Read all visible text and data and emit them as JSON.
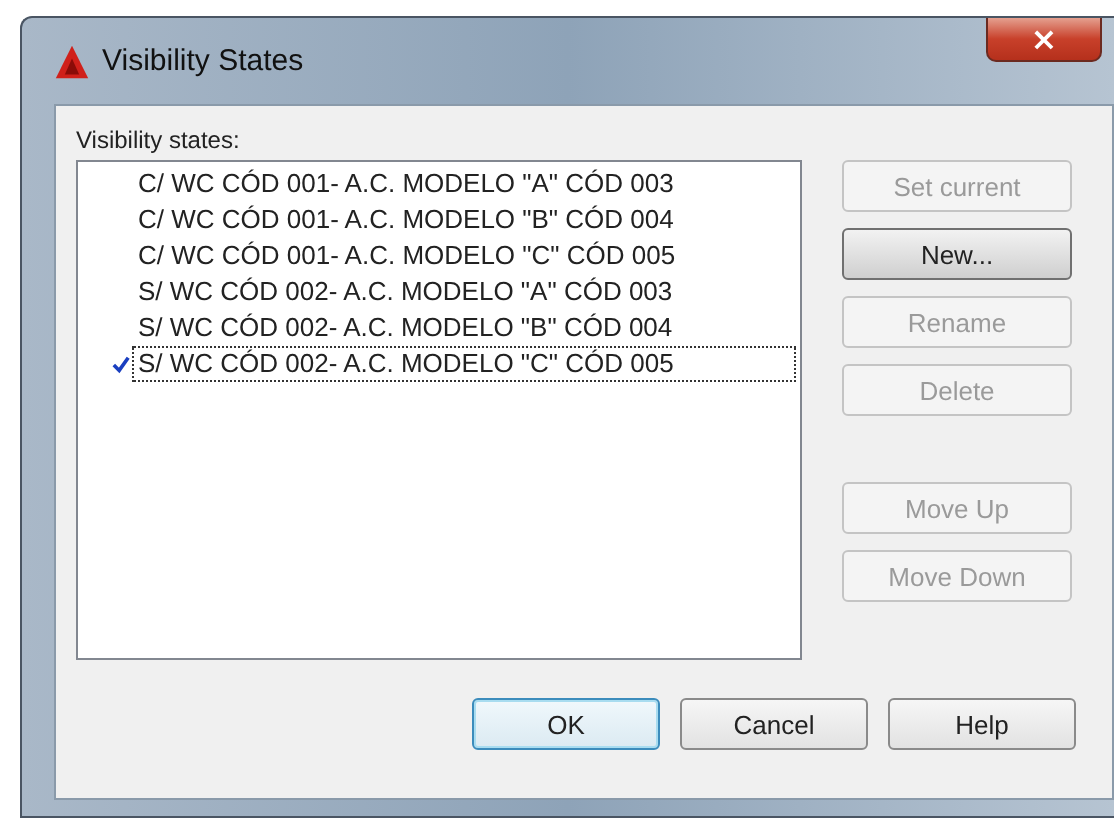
{
  "window": {
    "title": "Visibility States",
    "close": "×"
  },
  "list_label": "Visibility states:",
  "states": [
    {
      "name": "C/ WC CÓD 001- A.C. MODELO \"A\" CÓD 003",
      "current": false,
      "focused": false
    },
    {
      "name": "C/ WC CÓD 001- A.C. MODELO \"B\" CÓD 004",
      "current": false,
      "focused": false
    },
    {
      "name": "C/ WC CÓD 001- A.C. MODELO \"C\" CÓD 005",
      "current": false,
      "focused": false
    },
    {
      "name": "S/ WC CÓD 002- A.C. MODELO \"A\" CÓD 003",
      "current": false,
      "focused": false
    },
    {
      "name": "S/ WC CÓD 002- A.C. MODELO \"B\" CÓD 004",
      "current": false,
      "focused": false
    },
    {
      "name": "S/ WC CÓD 002- A.C. MODELO \"C\" CÓD 005",
      "current": true,
      "focused": true
    }
  ],
  "edit_buttons": [
    {
      "label": "Set current",
      "disabled": true,
      "hot": false
    },
    {
      "label": "New...",
      "disabled": false,
      "hot": true
    },
    {
      "label": "Rename",
      "disabled": true,
      "hot": false
    },
    {
      "label": "Delete",
      "disabled": true,
      "hot": false
    }
  ],
  "order_buttons": [
    {
      "label": "Move Up",
      "disabled": true,
      "hot": false
    },
    {
      "label": "Move Down",
      "disabled": true,
      "hot": false
    }
  ],
  "footer_buttons": [
    {
      "label": "OK",
      "default": true
    },
    {
      "label": "Cancel",
      "default": false
    },
    {
      "label": "Help",
      "default": false
    }
  ]
}
